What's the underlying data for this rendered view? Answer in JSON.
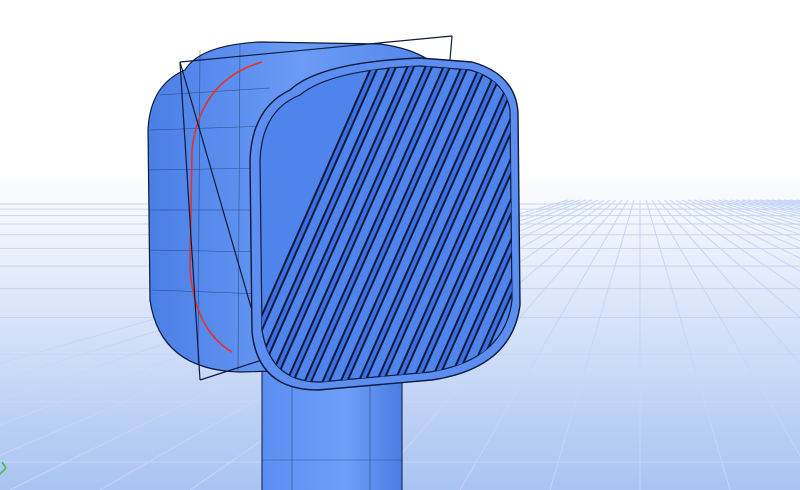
{
  "viewport": {
    "background_top": "#ffffff",
    "background_bottom": "#a9c3f2",
    "grid_color": "#c9d9f7",
    "model_color": "#5b8ef0",
    "model_shade": "#3f6fd9",
    "edge_color": "#0d1a3a",
    "highlight_edge_color": "#e0352b",
    "axis_color": "#2fbf3b"
  },
  "model": {
    "name": "hair-dryer-head",
    "grille_slot_count": 17
  }
}
